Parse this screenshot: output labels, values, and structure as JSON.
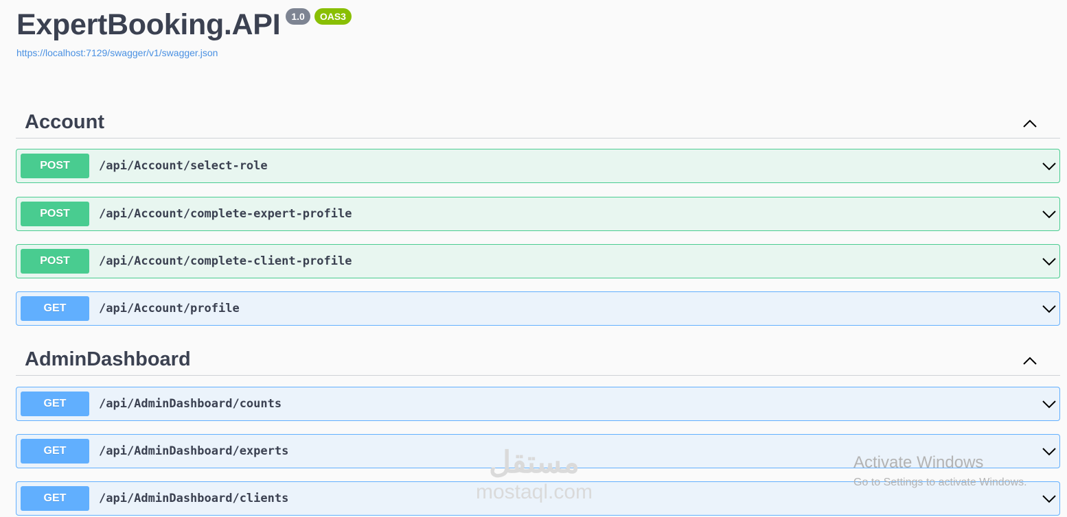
{
  "info": {
    "title": "ExpertBooking.API",
    "version": "1.0",
    "oas": "OAS3",
    "spec_url": "https://localhost:7129/swagger/v1/swagger.json"
  },
  "tags": [
    {
      "name": "Account",
      "operations": [
        {
          "method": "POST",
          "path": "/api/Account/select-role"
        },
        {
          "method": "POST",
          "path": "/api/Account/complete-expert-profile"
        },
        {
          "method": "POST",
          "path": "/api/Account/complete-client-profile"
        },
        {
          "method": "GET",
          "path": "/api/Account/profile"
        }
      ]
    },
    {
      "name": "AdminDashboard",
      "operations": [
        {
          "method": "GET",
          "path": "/api/AdminDashboard/counts"
        },
        {
          "method": "GET",
          "path": "/api/AdminDashboard/experts"
        },
        {
          "method": "GET",
          "path": "/api/AdminDashboard/clients"
        }
      ]
    }
  ],
  "watermark": {
    "title": "Activate Windows",
    "subtitle": "Go to Settings to activate Windows."
  },
  "overlay": {
    "logo_arabic": "مستقل",
    "logo_text": "mostaql.com"
  },
  "colors": {
    "post": "#49cc90",
    "get": "#61affe",
    "text": "#3b4151",
    "link": "#4990e2"
  },
  "icons": {
    "tag_toggle": "chevron-up-icon",
    "op_toggle": "chevron-down-icon"
  }
}
